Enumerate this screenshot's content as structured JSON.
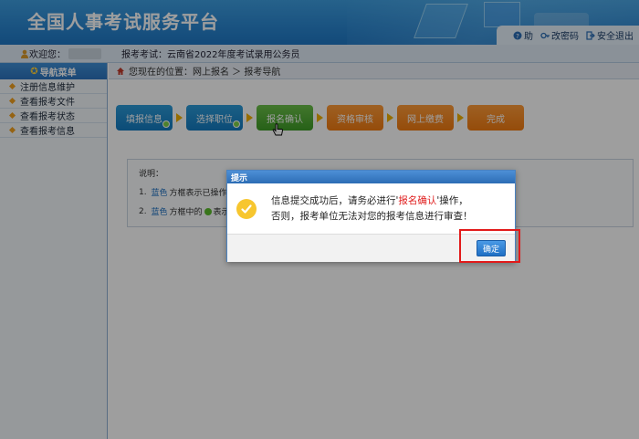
{
  "header": {
    "title": "全国人事考试服务平台",
    "links": [
      {
        "label": "助",
        "icon": "help-icon"
      },
      {
        "label": "改密码",
        "icon": "key-icon"
      },
      {
        "label": "安全退出",
        "icon": "exit-icon"
      }
    ]
  },
  "subbar": {
    "welcome": "欢迎您：",
    "exam_label": "报考考试：云南省2022年度考试录用公务员"
  },
  "sidebar": {
    "heading": "导航菜单",
    "items": [
      "注册信息维护",
      "查看报考文件",
      "查看报考状态",
      "查看报考信息"
    ]
  },
  "breadcrumb": {
    "text": "您现在的位置：网上报名 ＞ 报考导航"
  },
  "steps": [
    {
      "label": "填报信息",
      "color": "#1a85c8",
      "done": true
    },
    {
      "label": "选择职位",
      "color": "#1a85c8",
      "done": true
    },
    {
      "label": "报名确认",
      "color": "#4ea832",
      "done": false
    },
    {
      "label": "资格审核",
      "color": "#f58a1f",
      "done": false
    },
    {
      "label": "网上缴费",
      "color": "#f58a1f",
      "done": false
    },
    {
      "label": "完成",
      "color": "#f58a1f",
      "done": false
    }
  ],
  "notes": {
    "title": "说明：",
    "line1_num": "1.",
    "line1_blue": "蓝色",
    "line1_rest": "方框表示已操作，",
    "line2_num": "2.",
    "line2_blue": "蓝色",
    "line2_mid": "方框中的",
    "line2_rest": "表示可"
  },
  "dialog": {
    "title": "提示",
    "msg_part1": "信息提交成功后，请务必进行'",
    "msg_highlight": "报名确认",
    "msg_part2": "'操作，",
    "msg_line2": "否则，报考单位无法对您的报考信息进行审查！",
    "ok_label": "确定"
  }
}
